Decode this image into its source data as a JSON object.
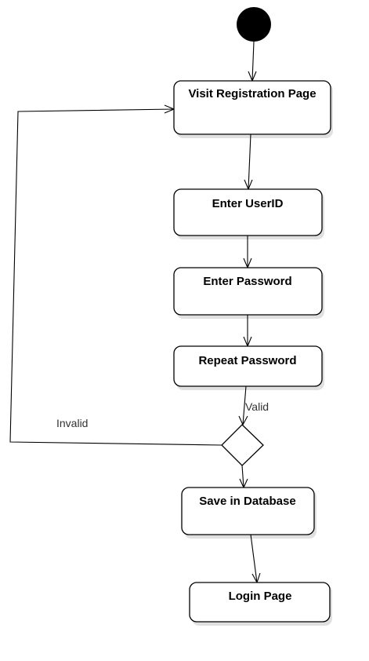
{
  "diagram": {
    "type": "activity-diagram",
    "nodes": {
      "visit_registration": "Visit Registration Page",
      "enter_userid": "Enter UserID",
      "enter_password": "Enter Password",
      "repeat_password": "Repeat Password",
      "save_database": "Save in Database",
      "login_page": "Login Page"
    },
    "edge_labels": {
      "valid": "Valid",
      "invalid": "Invalid"
    },
    "colors": {
      "stroke": "#000000",
      "fill": "#ffffff",
      "initial_node": "#000000",
      "edge_label": "#333333"
    }
  }
}
